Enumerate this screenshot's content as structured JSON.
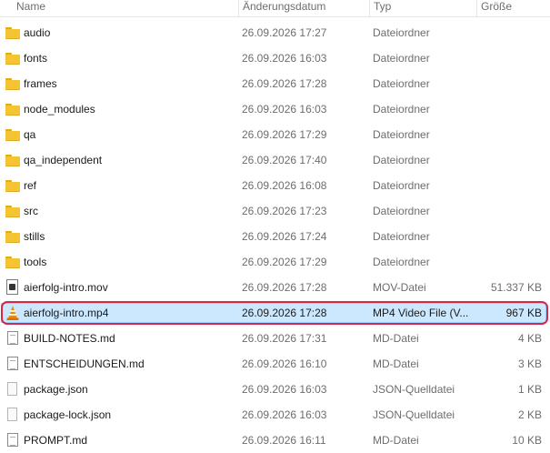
{
  "columns": {
    "name": "Name",
    "date": "Änderungsdatum",
    "type": "Typ",
    "size": "Größe"
  },
  "files": [
    {
      "name": "audio",
      "date": "26.09.2026 17:27",
      "type": "Dateiordner",
      "size": "",
      "icon": "folder-icon"
    },
    {
      "name": "fonts",
      "date": "26.09.2026 16:03",
      "type": "Dateiordner",
      "size": "",
      "icon": "folder-icon"
    },
    {
      "name": "frames",
      "date": "26.09.2026 17:28",
      "type": "Dateiordner",
      "size": "",
      "icon": "folder-icon"
    },
    {
      "name": "node_modules",
      "date": "26.09.2026 16:03",
      "type": "Dateiordner",
      "size": "",
      "icon": "folder-icon"
    },
    {
      "name": "qa",
      "date": "26.09.2026 17:29",
      "type": "Dateiordner",
      "size": "",
      "icon": "folder-icon"
    },
    {
      "name": "qa_independent",
      "date": "26.09.2026 17:40",
      "type": "Dateiordner",
      "size": "",
      "icon": "folder-icon"
    },
    {
      "name": "ref",
      "date": "26.09.2026 16:08",
      "type": "Dateiordner",
      "size": "",
      "icon": "folder-icon"
    },
    {
      "name": "src",
      "date": "26.09.2026 17:23",
      "type": "Dateiordner",
      "size": "",
      "icon": "folder-icon"
    },
    {
      "name": "stills",
      "date": "26.09.2026 17:24",
      "type": "Dateiordner",
      "size": "",
      "icon": "folder-icon"
    },
    {
      "name": "tools",
      "date": "26.09.2026 17:29",
      "type": "Dateiordner",
      "size": "",
      "icon": "folder-icon"
    },
    {
      "name": "aierfolg-intro.mov",
      "date": "26.09.2026 17:28",
      "type": "MOV-Datei",
      "size": "51.337 KB",
      "icon": "mov-file-icon"
    },
    {
      "name": "aierfolg-intro.mp4",
      "date": "26.09.2026 17:28",
      "type": "MP4 Video File (V...",
      "size": "967 KB",
      "icon": "vlc-cone-icon",
      "selected": true
    },
    {
      "name": "BUILD-NOTES.md",
      "date": "26.09.2026 17:31",
      "type": "MD-Datei",
      "size": "4 KB",
      "icon": "document-icon"
    },
    {
      "name": "ENTSCHEIDUNGEN.md",
      "date": "26.09.2026 16:10",
      "type": "MD-Datei",
      "size": "3 KB",
      "icon": "document-icon"
    },
    {
      "name": "package.json",
      "date": "26.09.2026 16:03",
      "type": "JSON-Quelldatei",
      "size": "1 KB",
      "icon": "json-file-icon"
    },
    {
      "name": "package-lock.json",
      "date": "26.09.2026 16:03",
      "type": "JSON-Quelldatei",
      "size": "2 KB",
      "icon": "json-file-icon"
    },
    {
      "name": "PROMPT.md",
      "date": "26.09.2026 16:11",
      "type": "MD-Datei",
      "size": "10 KB",
      "icon": "document-icon"
    }
  ],
  "colors": {
    "selection_fill": "#cce8ff",
    "highlight_ring": "#d62848",
    "folder": "#f5c433"
  }
}
